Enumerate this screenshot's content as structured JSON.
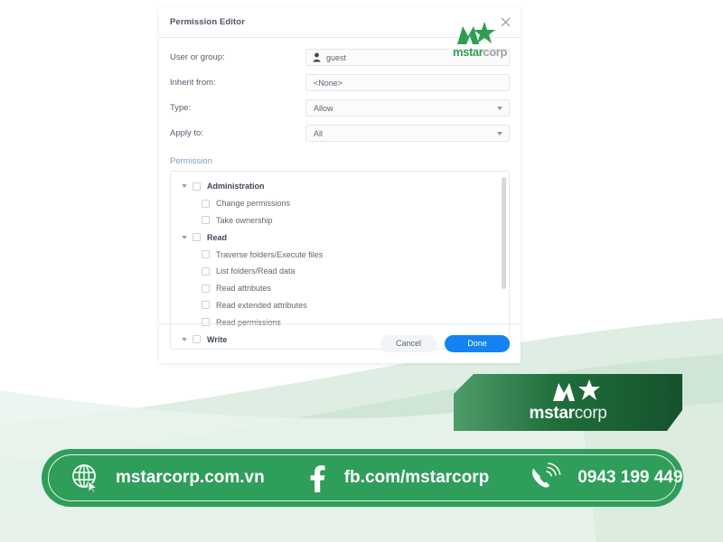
{
  "dialog": {
    "title": "Permission Editor",
    "close_icon": "close-icon",
    "fields": [
      {
        "label": "User or group:",
        "value": "guest",
        "icon": "person-icon",
        "type": "text"
      },
      {
        "label": "Inherit from:",
        "value": "<None>",
        "icon": "",
        "type": "text"
      },
      {
        "label": "Type:",
        "value": "Allow",
        "icon": "chevron-down-icon",
        "type": "select"
      },
      {
        "label": "Apply to:",
        "value": "All",
        "icon": "chevron-down-icon",
        "type": "select"
      }
    ],
    "permission_link": "Permission",
    "permission_rows": [
      {
        "level": "group",
        "label": "Administration",
        "checked": false,
        "expanded": true
      },
      {
        "level": "child",
        "label": "Change permissions",
        "checked": false
      },
      {
        "level": "child",
        "label": "Take ownership",
        "checked": false
      },
      {
        "level": "group",
        "label": "Read",
        "checked": false,
        "expanded": true
      },
      {
        "level": "child",
        "label": "Traverse folders/Execute files",
        "checked": false
      },
      {
        "level": "child",
        "label": "List folders/Read data",
        "checked": false
      },
      {
        "level": "child",
        "label": "Read attributes",
        "checked": false
      },
      {
        "level": "child",
        "label": "Read extended attributes",
        "checked": false
      },
      {
        "level": "child",
        "label": "Read permissions",
        "checked": false
      },
      {
        "level": "group",
        "label": "Write",
        "checked": false,
        "expanded": true
      }
    ],
    "buttons": {
      "cancel": "Cancel",
      "done": "Done"
    }
  },
  "watermark": {
    "name_bold": "mstar",
    "name_light": "corp"
  },
  "logo_banner": {
    "name_bold": "mstar",
    "name_light": "corp"
  },
  "contact_bar": {
    "website": {
      "icon": "globe-icon",
      "text": "mstarcorp.com.vn"
    },
    "facebook": {
      "icon": "facebook-icon",
      "text": "fb.com/mstarcorp"
    },
    "phone": {
      "icon": "phone-icon",
      "text": "0943 199 449"
    }
  },
  "colors": {
    "brand_green": "#2f9e5b",
    "banner_green_dark": "#1d6b3a",
    "accent_blue": "#1283f0",
    "link_blue": "#7ba2c9"
  }
}
